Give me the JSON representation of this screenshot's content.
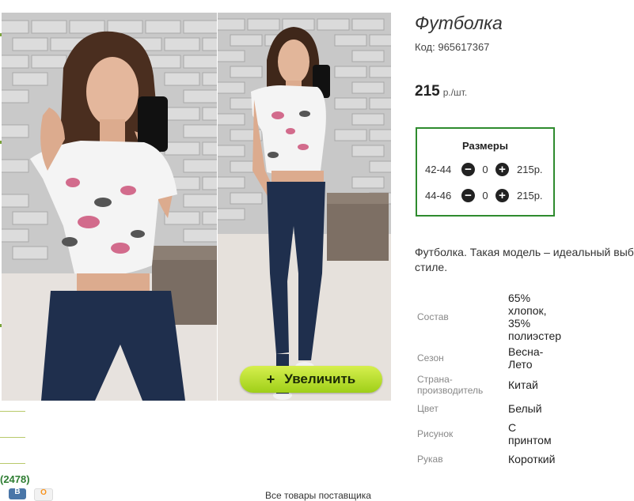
{
  "product": {
    "title": "Футболка",
    "code_label": "Код:",
    "code_value": "965617367",
    "price": "215",
    "price_unit": "р./шт."
  },
  "sizes": {
    "heading": "Размеры",
    "rows": [
      {
        "size": "42-44",
        "qty": "0",
        "price": "215р."
      },
      {
        "size": "44-46",
        "qty": "0",
        "price": "215р."
      }
    ]
  },
  "zoom": {
    "plus": "+",
    "label": "Увеличить"
  },
  "description": {
    "line1": "Футболка. Такая модель – идеальный выб",
    "line2": "стиле."
  },
  "properties": [
    {
      "label": "Состав",
      "value_lines": [
        "65%",
        "хлопок,",
        "35%",
        "полиэстер"
      ]
    },
    {
      "label": "Сезон",
      "value_lines": [
        "Весна-",
        "Лето"
      ]
    },
    {
      "label_lines": [
        "Страна-",
        "производитель"
      ],
      "value_lines": [
        "Китай"
      ]
    },
    {
      "label": "Цвет",
      "value_lines": [
        "Белый"
      ]
    },
    {
      "label": "Рисунок",
      "value_lines": [
        "С",
        "принтом"
      ]
    },
    {
      "label": "Рукав",
      "value_lines": [
        "Короткий"
      ]
    }
  ],
  "left_strip": {
    "count": "(2478)"
  },
  "social": {
    "vk_icon": "vk-icon",
    "ok_icon": "odnoklassniki-icon",
    "vk_glyph": "В",
    "ok_glyph": "О"
  },
  "bottom_cut_text": "Все товары поставщика"
}
